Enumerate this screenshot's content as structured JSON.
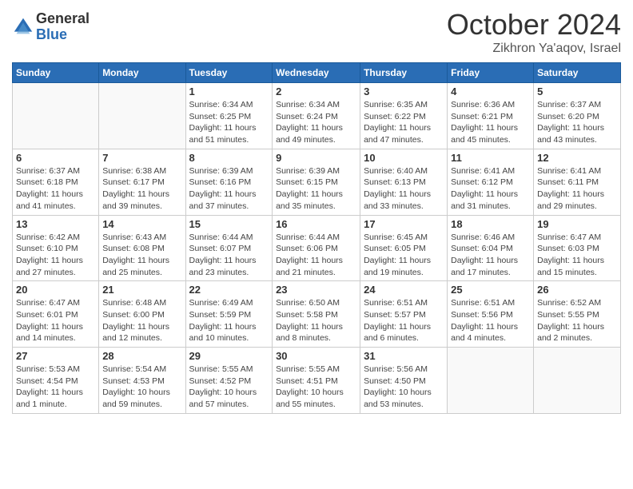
{
  "logo": {
    "general": "General",
    "blue": "Blue"
  },
  "header": {
    "month": "October 2024",
    "location": "Zikhron Ya'aqov, Israel"
  },
  "days_of_week": [
    "Sunday",
    "Monday",
    "Tuesday",
    "Wednesday",
    "Thursday",
    "Friday",
    "Saturday"
  ],
  "weeks": [
    [
      {
        "day": "",
        "info": ""
      },
      {
        "day": "",
        "info": ""
      },
      {
        "day": "1",
        "info": "Sunrise: 6:34 AM\nSunset: 6:25 PM\nDaylight: 11 hours and 51 minutes."
      },
      {
        "day": "2",
        "info": "Sunrise: 6:34 AM\nSunset: 6:24 PM\nDaylight: 11 hours and 49 minutes."
      },
      {
        "day": "3",
        "info": "Sunrise: 6:35 AM\nSunset: 6:22 PM\nDaylight: 11 hours and 47 minutes."
      },
      {
        "day": "4",
        "info": "Sunrise: 6:36 AM\nSunset: 6:21 PM\nDaylight: 11 hours and 45 minutes."
      },
      {
        "day": "5",
        "info": "Sunrise: 6:37 AM\nSunset: 6:20 PM\nDaylight: 11 hours and 43 minutes."
      }
    ],
    [
      {
        "day": "6",
        "info": "Sunrise: 6:37 AM\nSunset: 6:18 PM\nDaylight: 11 hours and 41 minutes."
      },
      {
        "day": "7",
        "info": "Sunrise: 6:38 AM\nSunset: 6:17 PM\nDaylight: 11 hours and 39 minutes."
      },
      {
        "day": "8",
        "info": "Sunrise: 6:39 AM\nSunset: 6:16 PM\nDaylight: 11 hours and 37 minutes."
      },
      {
        "day": "9",
        "info": "Sunrise: 6:39 AM\nSunset: 6:15 PM\nDaylight: 11 hours and 35 minutes."
      },
      {
        "day": "10",
        "info": "Sunrise: 6:40 AM\nSunset: 6:13 PM\nDaylight: 11 hours and 33 minutes."
      },
      {
        "day": "11",
        "info": "Sunrise: 6:41 AM\nSunset: 6:12 PM\nDaylight: 11 hours and 31 minutes."
      },
      {
        "day": "12",
        "info": "Sunrise: 6:41 AM\nSunset: 6:11 PM\nDaylight: 11 hours and 29 minutes."
      }
    ],
    [
      {
        "day": "13",
        "info": "Sunrise: 6:42 AM\nSunset: 6:10 PM\nDaylight: 11 hours and 27 minutes."
      },
      {
        "day": "14",
        "info": "Sunrise: 6:43 AM\nSunset: 6:08 PM\nDaylight: 11 hours and 25 minutes."
      },
      {
        "day": "15",
        "info": "Sunrise: 6:44 AM\nSunset: 6:07 PM\nDaylight: 11 hours and 23 minutes."
      },
      {
        "day": "16",
        "info": "Sunrise: 6:44 AM\nSunset: 6:06 PM\nDaylight: 11 hours and 21 minutes."
      },
      {
        "day": "17",
        "info": "Sunrise: 6:45 AM\nSunset: 6:05 PM\nDaylight: 11 hours and 19 minutes."
      },
      {
        "day": "18",
        "info": "Sunrise: 6:46 AM\nSunset: 6:04 PM\nDaylight: 11 hours and 17 minutes."
      },
      {
        "day": "19",
        "info": "Sunrise: 6:47 AM\nSunset: 6:03 PM\nDaylight: 11 hours and 15 minutes."
      }
    ],
    [
      {
        "day": "20",
        "info": "Sunrise: 6:47 AM\nSunset: 6:01 PM\nDaylight: 11 hours and 14 minutes."
      },
      {
        "day": "21",
        "info": "Sunrise: 6:48 AM\nSunset: 6:00 PM\nDaylight: 11 hours and 12 minutes."
      },
      {
        "day": "22",
        "info": "Sunrise: 6:49 AM\nSunset: 5:59 PM\nDaylight: 11 hours and 10 minutes."
      },
      {
        "day": "23",
        "info": "Sunrise: 6:50 AM\nSunset: 5:58 PM\nDaylight: 11 hours and 8 minutes."
      },
      {
        "day": "24",
        "info": "Sunrise: 6:51 AM\nSunset: 5:57 PM\nDaylight: 11 hours and 6 minutes."
      },
      {
        "day": "25",
        "info": "Sunrise: 6:51 AM\nSunset: 5:56 PM\nDaylight: 11 hours and 4 minutes."
      },
      {
        "day": "26",
        "info": "Sunrise: 6:52 AM\nSunset: 5:55 PM\nDaylight: 11 hours and 2 minutes."
      }
    ],
    [
      {
        "day": "27",
        "info": "Sunrise: 5:53 AM\nSunset: 4:54 PM\nDaylight: 11 hours and 1 minute."
      },
      {
        "day": "28",
        "info": "Sunrise: 5:54 AM\nSunset: 4:53 PM\nDaylight: 10 hours and 59 minutes."
      },
      {
        "day": "29",
        "info": "Sunrise: 5:55 AM\nSunset: 4:52 PM\nDaylight: 10 hours and 57 minutes."
      },
      {
        "day": "30",
        "info": "Sunrise: 5:55 AM\nSunset: 4:51 PM\nDaylight: 10 hours and 55 minutes."
      },
      {
        "day": "31",
        "info": "Sunrise: 5:56 AM\nSunset: 4:50 PM\nDaylight: 10 hours and 53 minutes."
      },
      {
        "day": "",
        "info": ""
      },
      {
        "day": "",
        "info": ""
      }
    ]
  ]
}
